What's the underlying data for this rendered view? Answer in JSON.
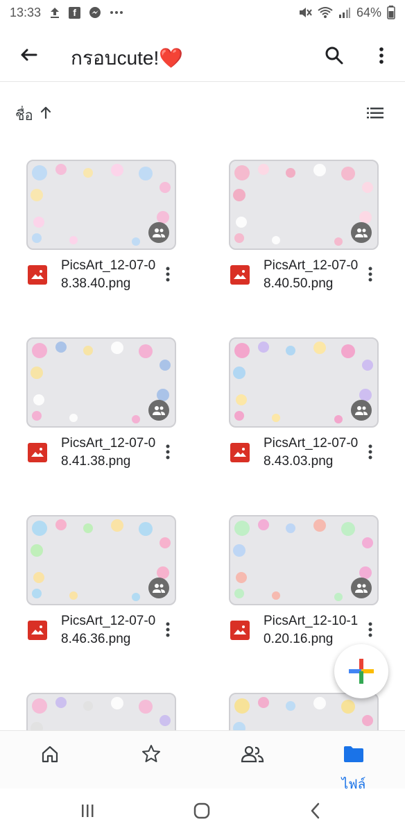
{
  "status_bar": {
    "time": "13:33",
    "battery": "64%",
    "icons_left": [
      "upload-icon",
      "facebook-icon",
      "messenger-icon",
      "more-dots-icon"
    ],
    "icons_right": [
      "mute-icon",
      "wifi-icon",
      "signal-icon"
    ]
  },
  "app_bar": {
    "title": "กรอบcute!❤️",
    "back_icon": "arrow-back-icon",
    "search_icon": "search-icon",
    "more_icon": "more-vert-icon"
  },
  "sort": {
    "label": "ชื่อ",
    "direction_icon": "arrow-up-icon",
    "view_toggle_icon": "list-view-icon"
  },
  "files": [
    {
      "name": "PicsArt_12-07-08.38.40.png",
      "type_icon": "image-file-icon",
      "shared": true,
      "palette": [
        "#b9d8f7",
        "#f8b6d6",
        "#fbe6a6",
        "#ffd0ea"
      ]
    },
    {
      "name": "PicsArt_12-07-08.40.50.png",
      "type_icon": "image-file-icon",
      "shared": true,
      "palette": [
        "#f7b1c9",
        "#ffd6e4",
        "#f3a3bd",
        "#ffffff"
      ]
    },
    {
      "name": "PicsArt_12-07-08.41.38.png",
      "type_icon": "image-file-icon",
      "shared": true,
      "palette": [
        "#f6a7cf",
        "#9fbce8",
        "#f9e39a",
        "#ffffff"
      ]
    },
    {
      "name": "PicsArt_12-07-08.43.03.png",
      "type_icon": "image-file-icon",
      "shared": true,
      "palette": [
        "#f49ac7",
        "#c9b6f2",
        "#a7d3f5",
        "#ffe69b"
      ]
    },
    {
      "name": "PicsArt_12-07-08.46.36.png",
      "type_icon": "image-file-icon",
      "shared": true,
      "palette": [
        "#a8d8f5",
        "#f9a8c8",
        "#b9f0b2",
        "#fde29a"
      ]
    },
    {
      "name": "PicsArt_12-10-10.20.16.png",
      "type_icon": "image-file-icon",
      "shared": true,
      "palette": [
        "#b9f0c0",
        "#f4a3d2",
        "#b6d2f7",
        "#f8b2a6"
      ]
    },
    {
      "name": "",
      "type_icon": "image-file-icon",
      "shared": false,
      "palette": [
        "#f7b4d4",
        "#c7b8f0",
        "#e0e0e0",
        "#ffffff"
      ]
    },
    {
      "name": "",
      "type_icon": "image-file-icon",
      "shared": false,
      "palette": [
        "#f9e08a",
        "#f4a3c8",
        "#b6d9f7",
        "#ffffff"
      ]
    }
  ],
  "fab": {
    "icon": "plus-icon",
    "colors": [
      "#ea4335",
      "#fbbc05",
      "#34a853",
      "#4285f4"
    ]
  },
  "bottom_nav": {
    "items": [
      {
        "icon": "home-icon",
        "label": "",
        "active": false
      },
      {
        "icon": "star-icon",
        "label": "",
        "active": false
      },
      {
        "icon": "shared-people-icon",
        "label": "",
        "active": false
      },
      {
        "icon": "folder-icon",
        "label": "ไฟล์",
        "active": true
      }
    ],
    "active_color": "#1a73e8"
  },
  "system_nav": {
    "icons": [
      "recent-apps-icon",
      "home-button-icon",
      "back-button-icon"
    ]
  }
}
